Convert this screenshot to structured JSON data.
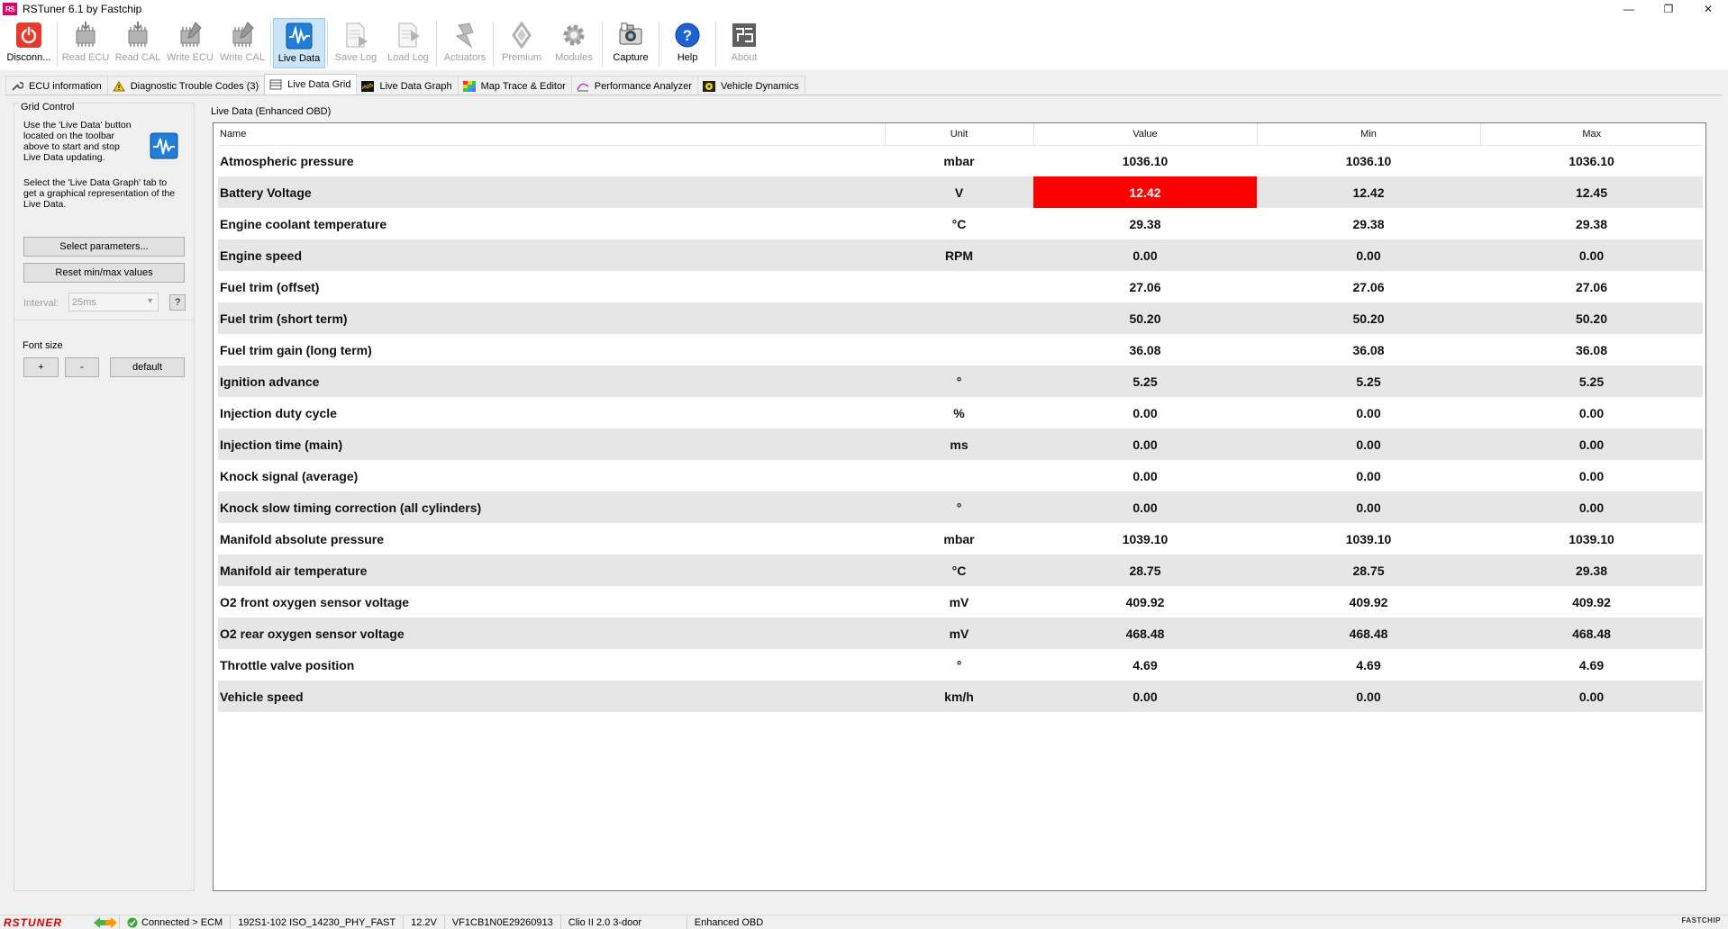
{
  "window": {
    "logo_text": "RS",
    "title": "RSTuner 6.1 by Fastchip",
    "minimize": "—",
    "maximize": "❐",
    "close": "✕"
  },
  "toolbar": [
    {
      "label": "Disconn...",
      "icon": "power-icon",
      "state": "normal"
    },
    {
      "label": "Read ECU",
      "icon": "chip-read-icon",
      "state": "disabled"
    },
    {
      "label": "Read CAL",
      "icon": "chip-read-icon",
      "state": "disabled"
    },
    {
      "label": "Write ECU",
      "icon": "chip-write-icon",
      "state": "disabled"
    },
    {
      "label": "Write CAL",
      "icon": "chip-write-icon",
      "state": "disabled"
    },
    {
      "label": "Live Data",
      "icon": "pulse-icon",
      "state": "active"
    },
    {
      "label": "Save Log",
      "icon": "save-log-icon",
      "state": "disabled"
    },
    {
      "label": "Load Log",
      "icon": "load-log-icon",
      "state": "disabled"
    },
    {
      "label": "Actuators",
      "icon": "actuator-icon",
      "state": "disabled"
    },
    {
      "label": "Premium",
      "icon": "renault-icon",
      "state": "disabled"
    },
    {
      "label": "Modules",
      "icon": "gear-icon",
      "state": "disabled"
    },
    {
      "label": "Capture",
      "icon": "camera-icon",
      "state": "normal"
    },
    {
      "label": "Help",
      "icon": "help-icon",
      "state": "normal"
    },
    {
      "label": "About",
      "icon": "about-logo-icon",
      "state": "disabled"
    }
  ],
  "tabs": [
    {
      "label": "ECU information",
      "icon": "wrench-icon",
      "active": false
    },
    {
      "label": "Diagnostic Trouble Codes (3)",
      "icon": "warning-icon",
      "active": false
    },
    {
      "label": "Live Data Grid",
      "icon": "grid-icon",
      "active": true
    },
    {
      "label": "Live Data Graph",
      "icon": "graph-icon",
      "active": false
    },
    {
      "label": "Map Trace & Editor",
      "icon": "map-icon",
      "active": false
    },
    {
      "label": "Performance Analyzer",
      "icon": "analyzer-icon",
      "active": false
    },
    {
      "label": "Vehicle Dynamics",
      "icon": "dynamics-icon",
      "active": false
    }
  ],
  "grid_control": {
    "title": "Grid Control",
    "hint1": [
      "Use the 'Live Data' button",
      "located on the toolbar",
      "above to start and stop",
      "Live Data updating."
    ],
    "hint2": [
      "Select the 'Live Data Graph' tab to",
      "get a graphical representation of the",
      "Live Data."
    ],
    "select_params": "Select parameters...",
    "reset_minmax": "Reset min/max values",
    "interval_label": "Interval:",
    "interval_value": "25ms",
    "help_btn": "?"
  },
  "font_size": {
    "title": "Font size",
    "plus": "+",
    "minus": "-",
    "default": "default"
  },
  "grid": {
    "title": "Live Data (Enhanced OBD)",
    "columns": [
      "Name",
      "Unit",
      "Value",
      "Min",
      "Max"
    ],
    "rows": [
      {
        "name": "Atmospheric pressure",
        "unit": "mbar",
        "value": "1036.10",
        "min": "1036.10",
        "max": "1036.10",
        "alert": false
      },
      {
        "name": "Battery Voltage",
        "unit": "V",
        "value": "12.42",
        "min": "12.42",
        "max": "12.45",
        "alert": true
      },
      {
        "name": "Engine coolant temperature",
        "unit": "°C",
        "value": "29.38",
        "min": "29.38",
        "max": "29.38",
        "alert": false
      },
      {
        "name": "Engine speed",
        "unit": "RPM",
        "value": "0.00",
        "min": "0.00",
        "max": "0.00",
        "alert": false
      },
      {
        "name": "Fuel trim (offset)",
        "unit": "",
        "value": "27.06",
        "min": "27.06",
        "max": "27.06",
        "alert": false
      },
      {
        "name": "Fuel trim (short term)",
        "unit": "",
        "value": "50.20",
        "min": "50.20",
        "max": "50.20",
        "alert": false
      },
      {
        "name": "Fuel trim gain (long term)",
        "unit": "",
        "value": "36.08",
        "min": "36.08",
        "max": "36.08",
        "alert": false
      },
      {
        "name": "Ignition advance",
        "unit": "°",
        "value": "5.25",
        "min": "5.25",
        "max": "5.25",
        "alert": false
      },
      {
        "name": "Injection duty cycle",
        "unit": "%",
        "value": "0.00",
        "min": "0.00",
        "max": "0.00",
        "alert": false
      },
      {
        "name": "Injection time (main)",
        "unit": "ms",
        "value": "0.00",
        "min": "0.00",
        "max": "0.00",
        "alert": false
      },
      {
        "name": "Knock signal (average)",
        "unit": "",
        "value": "0.00",
        "min": "0.00",
        "max": "0.00",
        "alert": false
      },
      {
        "name": "Knock slow timing correction (all cylinders)",
        "unit": "°",
        "value": "0.00",
        "min": "0.00",
        "max": "0.00",
        "alert": false
      },
      {
        "name": "Manifold absolute pressure",
        "unit": "mbar",
        "value": "1039.10",
        "min": "1039.10",
        "max": "1039.10",
        "alert": false
      },
      {
        "name": "Manifold air temperature",
        "unit": "°C",
        "value": "28.75",
        "min": "28.75",
        "max": "29.38",
        "alert": false
      },
      {
        "name": "O2 front oxygen sensor voltage",
        "unit": "mV",
        "value": "409.92",
        "min": "409.92",
        "max": "409.92",
        "alert": false
      },
      {
        "name": "O2 rear oxygen sensor voltage",
        "unit": "mV",
        "value": "468.48",
        "min": "468.48",
        "max": "468.48",
        "alert": false
      },
      {
        "name": "Throttle valve position",
        "unit": "°",
        "value": "4.69",
        "min": "4.69",
        "max": "4.69",
        "alert": false
      },
      {
        "name": "Vehicle speed",
        "unit": "km/h",
        "value": "0.00",
        "min": "0.00",
        "max": "0.00",
        "alert": false
      }
    ]
  },
  "statusbar": {
    "logo": "RSTUNER",
    "connection": "Connected > ECM",
    "protocol": "192S1-102  ISO_14230_PHY_FAST",
    "voltage": "12.2V",
    "vin": "VF1CB1N0E29260913",
    "vehicle": "Clio II 2.0 3-door",
    "mode": "Enhanced OBD",
    "brand": "FASTCHIP"
  },
  "colors": {
    "alert": "#ff0000",
    "active_tool": "#cce4f7",
    "brand": "#e2006a"
  }
}
